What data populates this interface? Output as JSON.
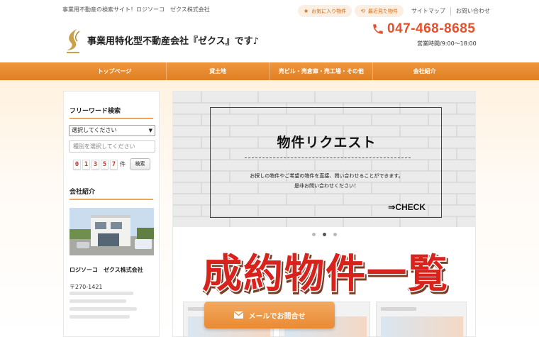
{
  "header": {
    "tagline": "事業用不動産の検索サイト！ロジソーコ　ゼクス株式会社",
    "favorites_label": "お気に入り物件",
    "recent_label": "最近見た物件",
    "sitemap_label": "サイトマップ",
    "contact_label": "お問い合わせ",
    "site_title": "事業用特化型不動産会社『ゼクス』です♪",
    "phone": "047-468-8685",
    "hours": "営業時間/9:00～18:00"
  },
  "nav": {
    "items": [
      {
        "label": "トップページ"
      },
      {
        "label": "貸土地"
      },
      {
        "label": "売ビル・売倉庫・売工場・その他"
      },
      {
        "label": "会社紹介"
      }
    ]
  },
  "sidebar": {
    "search_heading": "フリーワード検索",
    "select_value": "選択してください",
    "input_placeholder": "種別を選択してください",
    "count_digits": [
      "0",
      "1",
      "3",
      "5",
      "7"
    ],
    "count_unit": "件",
    "search_button": "検索",
    "company_heading": "会社紹介",
    "company_name": "ロジソーコ　ゼクス株式会社",
    "postal": "〒270-1421"
  },
  "slider": {
    "title": "物件リクエスト",
    "desc_line1": "お探しの物件やご希望の物件を直接、問い合わせることができます。",
    "desc_line2": "是非お問い合わせください！",
    "check_label": "⇒CHECK",
    "slide_count": 3,
    "active_index": 1
  },
  "banner": {
    "text": "成約物件一覧"
  },
  "floating": {
    "mail_button": "メールでお問合せ"
  },
  "colors": {
    "accent": "#e9872b",
    "phone": "#e7502c",
    "banner_red": "#d8231e"
  }
}
